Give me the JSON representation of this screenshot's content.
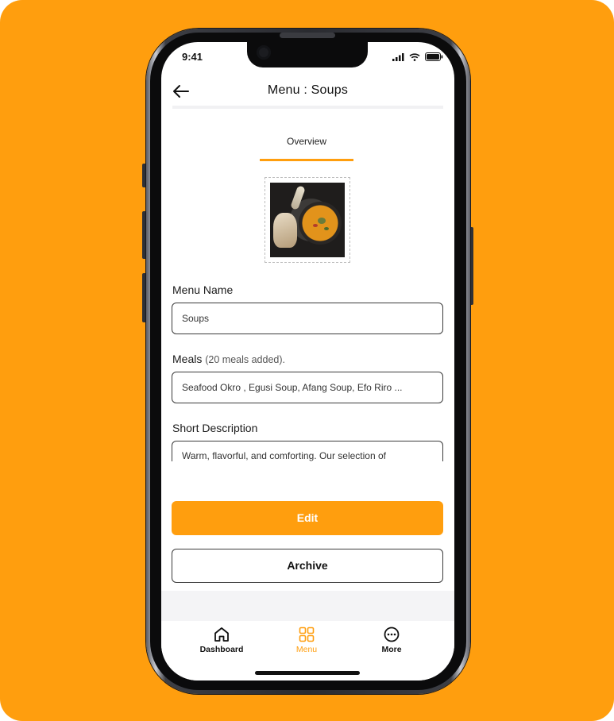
{
  "status_bar": {
    "time": "9:41"
  },
  "header": {
    "title": "Menu : Soups"
  },
  "tabs": [
    {
      "label": "Overview",
      "active": true
    }
  ],
  "form": {
    "menu_name": {
      "label": "Menu Name",
      "value": "Soups"
    },
    "meals": {
      "label": "Meals",
      "count_note": "(20 meals added).",
      "value": "Seafood Okro , Egusi Soup, Afang Soup, Efo Riro ..."
    },
    "short_description": {
      "label": "Short Description",
      "value": "Warm, flavorful, and comforting. Our selection of"
    }
  },
  "actions": {
    "edit_label": "Edit",
    "archive_label": "Archive"
  },
  "bottom_nav": {
    "items": [
      {
        "label": "Dashboard",
        "icon": "home-icon",
        "active": false
      },
      {
        "label": "Menu",
        "icon": "grid-icon",
        "active": true
      },
      {
        "label": "More",
        "icon": "more-icon",
        "active": false
      }
    ]
  },
  "colors": {
    "accent": "#FF9E0E",
    "background": "#FF9E0E",
    "text_primary": "#111111",
    "border": "#3B3B3B"
  }
}
